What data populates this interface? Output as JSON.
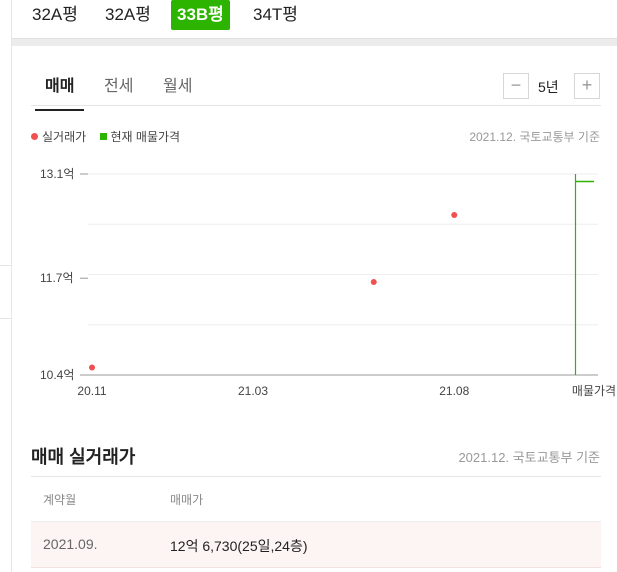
{
  "type_tabs": [
    {
      "label": "32A평",
      "active": false
    },
    {
      "label": "32A평",
      "active": false
    },
    {
      "label": "33B평",
      "active": true
    },
    {
      "label": "34T평",
      "active": false
    }
  ],
  "deal_tabs": [
    {
      "label": "매매",
      "active": true
    },
    {
      "label": "전세",
      "active": false
    },
    {
      "label": "월세",
      "active": false
    }
  ],
  "period": {
    "label": "5년",
    "minus": "−",
    "plus": "+"
  },
  "legend": {
    "actual": "실거래가",
    "current": "현재 매물가격"
  },
  "source": "2021.12. 국토교통부 기준",
  "colors": {
    "actual": "#f0504f",
    "current": "#2db400",
    "accent": "#2db400"
  },
  "chart_data": {
    "type": "scatter",
    "x_ticks": [
      "20.11",
      "21.03",
      "21.08"
    ],
    "x_end_label": "매물가격",
    "x_range": [
      "2020-11",
      "2021-11"
    ],
    "y_ticks": [
      "13.1억",
      "11.7억",
      "10.4억"
    ],
    "y_values": [
      13.1,
      11.7,
      10.4
    ],
    "ylim": [
      10.4,
      13.1
    ],
    "grid": true,
    "series": [
      {
        "name": "실거래가",
        "points": [
          {
            "x": "2020-11",
            "y": 10.5
          },
          {
            "x": "2021-06",
            "y": 11.65
          },
          {
            "x": "2021-08",
            "y": 12.55
          }
        ]
      }
    ],
    "current_listing": {
      "name": "현재 매물가격",
      "min": 10.4,
      "max": 13.1,
      "marker": 13.0
    }
  },
  "table": {
    "title": "매매 실거래가",
    "source": "2021.12. 국토교통부 기준",
    "headers": {
      "date": "계약월",
      "price": "매매가"
    },
    "rows": [
      {
        "date": "2021.09.",
        "price": "12억 6,730(25일,24층)"
      }
    ]
  }
}
